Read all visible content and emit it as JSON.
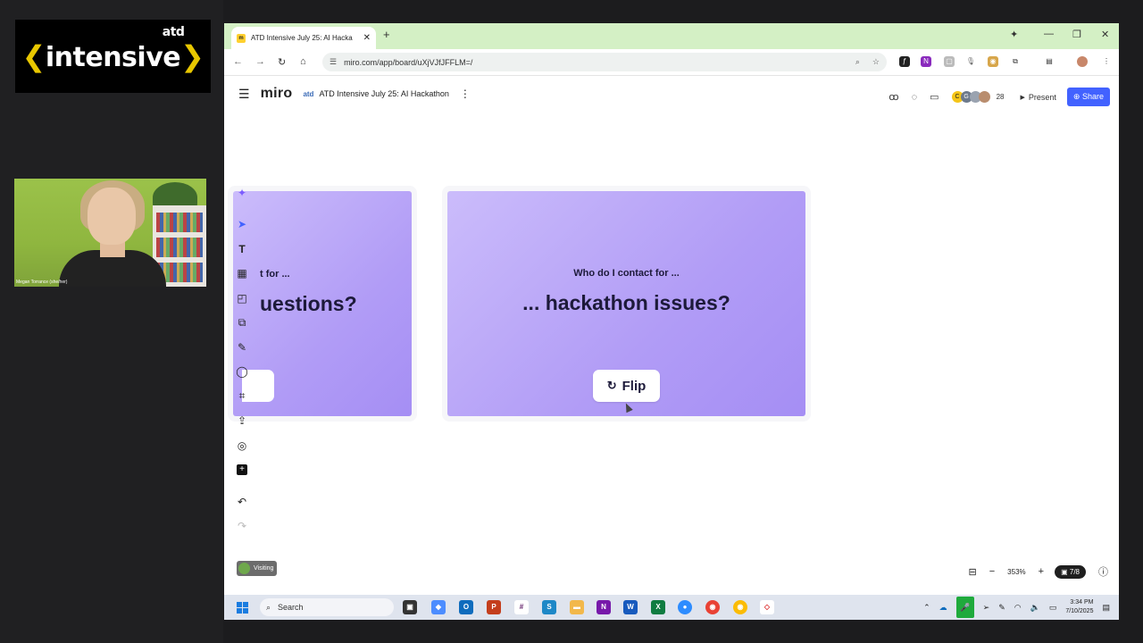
{
  "overlay": {
    "logo_atd": "atd",
    "logo_text": "intensive",
    "logo_left": "❮",
    "logo_right": "❯",
    "webcam_caption": "Megan Torrance (she/her)"
  },
  "browser": {
    "tab_title": "ATD Intensive July 25: AI Hacka",
    "tab_close": "✕",
    "new_tab": "+",
    "url": "miro.com/app/board/uXjVJfJFFLM=/",
    "win_min": "—",
    "win_restore": "❐",
    "win_close": "✕"
  },
  "miro": {
    "logo": "miro",
    "board_org": "atd",
    "board_title": "ATD Intensive July 25: AI Hackathon",
    "collaborator_count": "28",
    "avatars": [
      "C",
      "G",
      "",
      ""
    ],
    "avatar_colors": [
      "#f5c518",
      "#6d7a8c",
      "#9aa3b0",
      "#b98d6e"
    ],
    "present_label": "Present",
    "share_label": "Share"
  },
  "cards": {
    "left_small": "t for ...",
    "left_big": "uestions?",
    "main_small": "Who do I contact for ...",
    "main_big": "... hackathon issues?",
    "flip_label": "Flip"
  },
  "canvas_footer": {
    "visiting_label": "Visiting",
    "zoom": "353%",
    "frames": "7/8"
  },
  "taskbar": {
    "search_placeholder": "Search",
    "time": "3:34 PM",
    "date": "7/10/2025"
  },
  "colors": {
    "share_blue": "#4262ff",
    "card_purple": "#b19cf6",
    "tab_green": "#d4f0c5"
  }
}
